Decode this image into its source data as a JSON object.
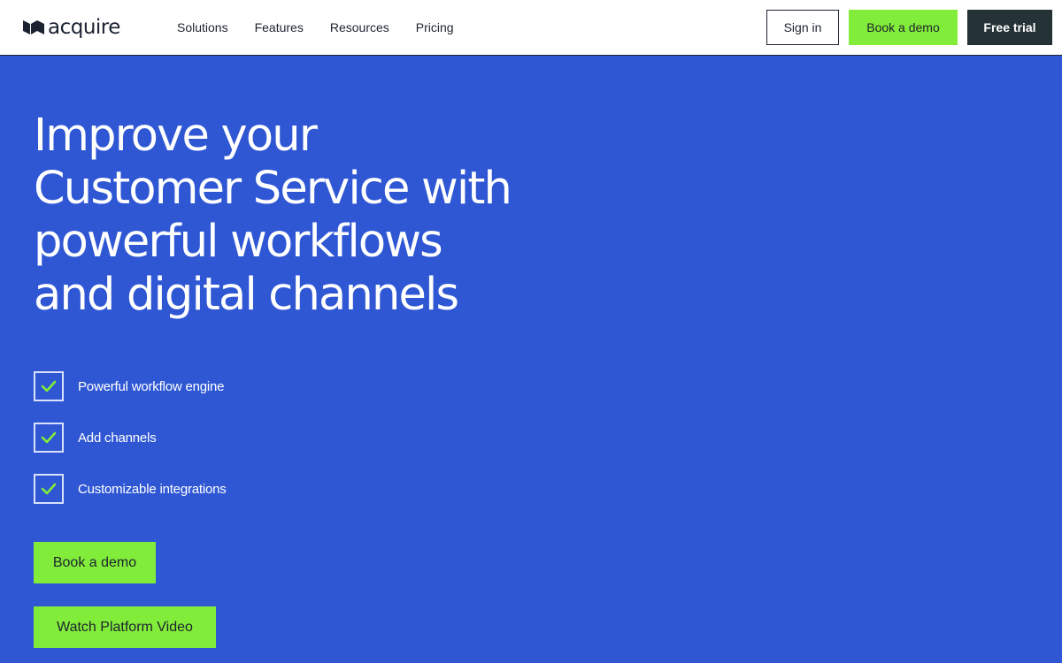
{
  "brand": {
    "name": "acquire",
    "accent_color": "#82ec3a",
    "hero_background": "#2f57d4",
    "dark_color": "#253236"
  },
  "nav": {
    "items": [
      {
        "label": "Solutions"
      },
      {
        "label": "Features"
      },
      {
        "label": "Resources"
      },
      {
        "label": "Pricing"
      }
    ]
  },
  "header_actions": {
    "signin": "Sign in",
    "book_demo": "Book a demo",
    "free_trial": "Free trial"
  },
  "hero": {
    "title_lines": [
      "Improve your",
      "Customer Service with",
      "powerful workflows",
      "and digital channels"
    ],
    "features": [
      {
        "label": "Powerful workflow engine",
        "icon": "check-icon"
      },
      {
        "label": "Add channels",
        "icon": "check-icon"
      },
      {
        "label": "Customizable integrations",
        "icon": "check-icon"
      }
    ],
    "cta_primary": "Book a demo",
    "cta_secondary": "Watch Platform Video"
  }
}
